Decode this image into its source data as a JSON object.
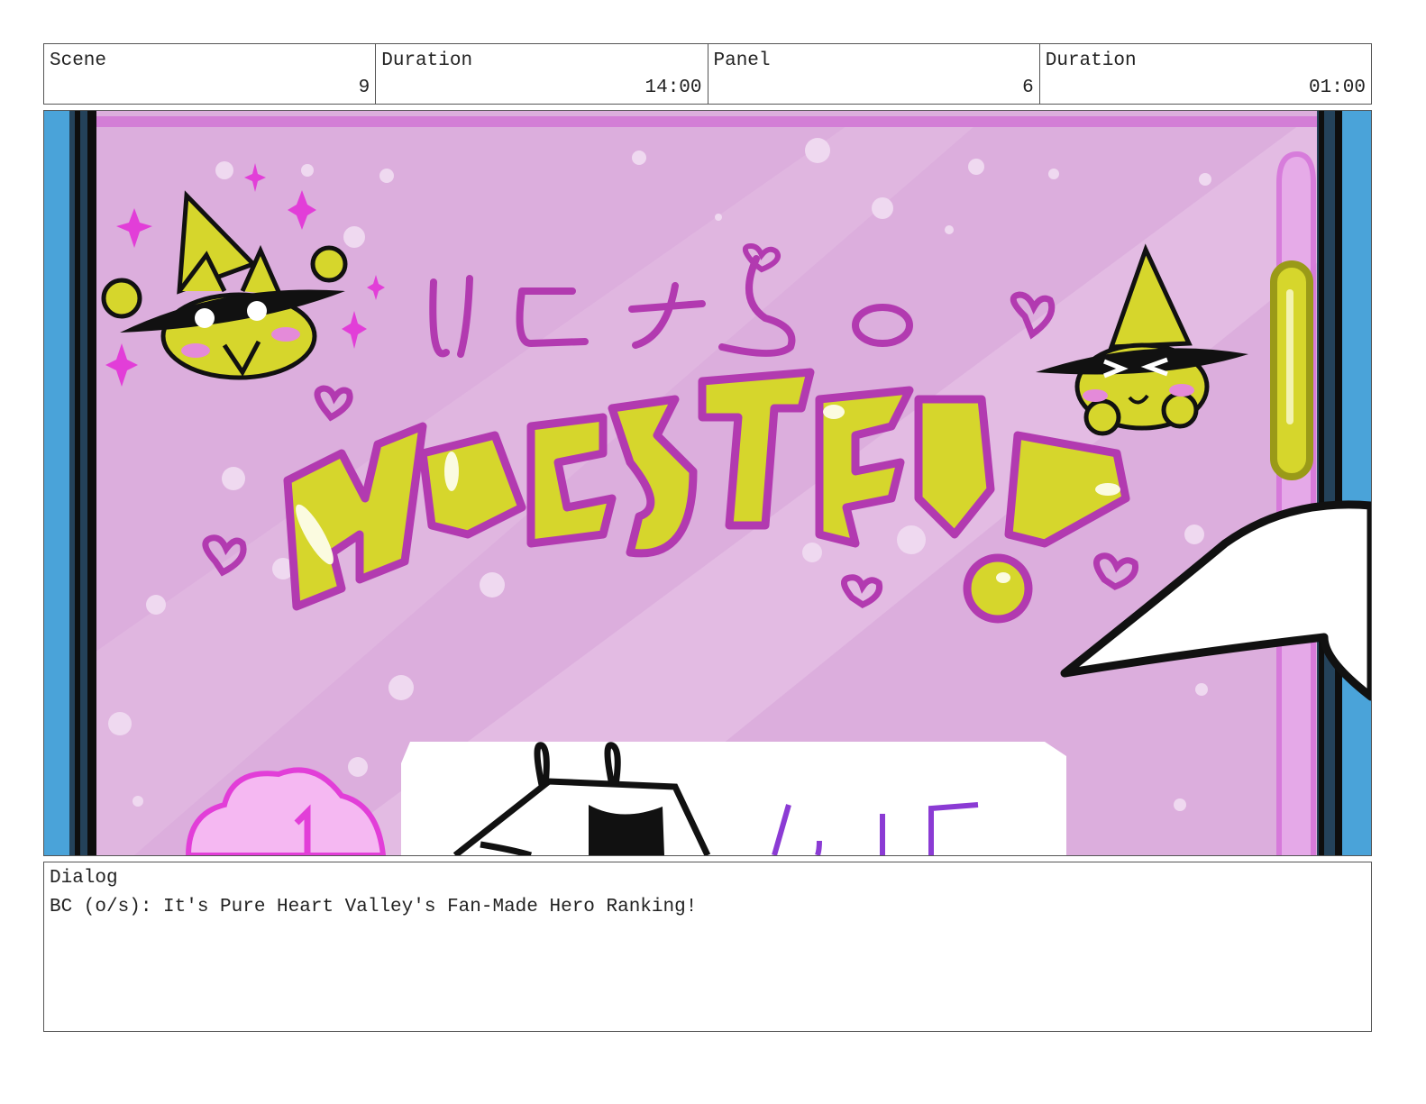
{
  "header": {
    "scene_label": "Scene",
    "scene_value": "9",
    "scene_duration_label": "Duration",
    "scene_duration_value": "14:00",
    "panel_label": "Panel",
    "panel_value": "6",
    "panel_duration_label": "Duration",
    "panel_duration_value": "01:00"
  },
  "panel": {
    "colors": {
      "background": "#dcaedd",
      "frame_blue": "#4aa3d9",
      "frame_dark": "#24425a",
      "magenta": "#b23ab0",
      "yellow": "#d6d62c",
      "pink_light": "#f5b8f2"
    },
    "icons": [
      "cat-mascot-left",
      "cat-mascot-right",
      "hashtag-logo",
      "hearts",
      "sparkles",
      "pointing-hand",
      "character-head"
    ]
  },
  "dialog": {
    "label": "Dialog",
    "text": "BC (o/s): It's Pure Heart Valley's Fan-Made Hero Ranking!"
  }
}
